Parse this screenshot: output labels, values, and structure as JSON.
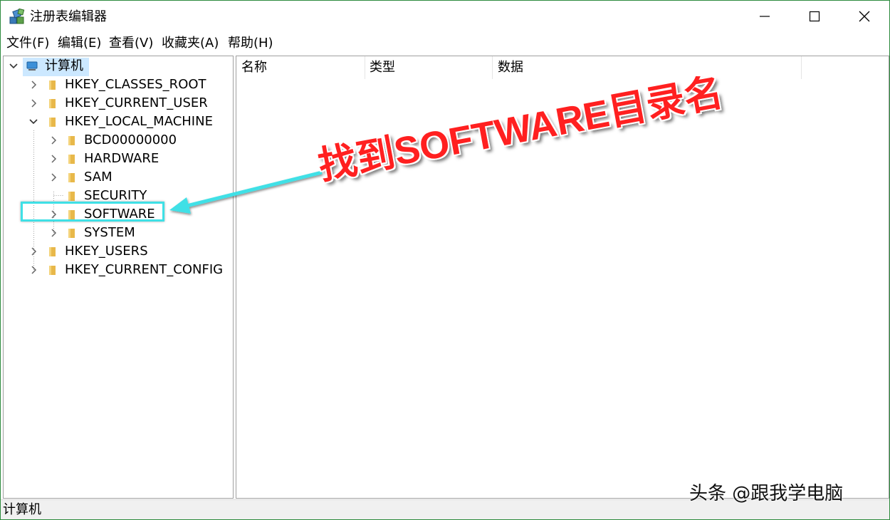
{
  "window": {
    "title": "注册表编辑器",
    "minimize_icon": "minimize-icon",
    "maximize_icon": "maximize-icon",
    "close_icon": "close-icon"
  },
  "menu": [
    "文件(F)",
    "编辑(E)",
    "查看(V)",
    "收藏夹(A)",
    "帮助(H)"
  ],
  "tree": {
    "root": {
      "label": "计算机",
      "icon": "computer-icon",
      "expanded": true,
      "selected": true
    },
    "hives": [
      {
        "label": "HKEY_CLASSES_ROOT",
        "expanded": false
      },
      {
        "label": "HKEY_CURRENT_USER",
        "expanded": false
      },
      {
        "label": "HKEY_LOCAL_MACHINE",
        "expanded": true,
        "children": [
          {
            "label": "BCD00000000",
            "has_children": true
          },
          {
            "label": "HARDWARE",
            "has_children": true
          },
          {
            "label": "SAM",
            "has_children": true
          },
          {
            "label": "SECURITY",
            "has_children": false
          },
          {
            "label": "SOFTWARE",
            "has_children": true,
            "highlighted": true
          },
          {
            "label": "SYSTEM",
            "has_children": true
          }
        ]
      },
      {
        "label": "HKEY_USERS",
        "expanded": false
      },
      {
        "label": "HKEY_CURRENT_CONFIG",
        "expanded": false
      }
    ]
  },
  "list": {
    "columns": [
      "名称",
      "类型",
      "数据"
    ]
  },
  "status": {
    "path": "计算机"
  },
  "annotation": {
    "text": "找到SOFTWARE目录名",
    "color": "#ff2020",
    "box_color": "#3fe0e6"
  },
  "watermark": "头条 @跟我学电脑",
  "colors": {
    "folder": "#e8b84a",
    "selection": "#cce8ff",
    "border": "#2e8b3e"
  }
}
